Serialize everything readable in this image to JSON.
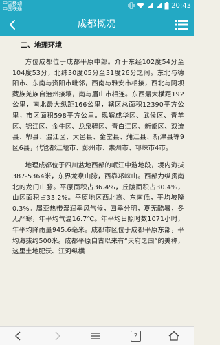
{
  "status": {
    "carrier_line1": "中国移动",
    "carrier_line2": "中国联通",
    "time": "20:43"
  },
  "header": {
    "title": "成都概况"
  },
  "content": {
    "heading": "二、地理环境",
    "paragraphs": [
      "方位成都位于成都平原中部。介于东经102度54分至104度53分，北纬30度05分至31度26分之间。东北与德阳市、东南与资阳市毗邻，西南与雅安市相接，西北与阿坝藏族羌族自治州接壤，南与眉山市相连。东西最大横距192公里，南北最大纵距166公里，辖区总面积12390平方公里，市区面积598平方公里。现辖成华区、武侯区、青羊区、锦江区、金牛区、龙泉驿区、青白江区、新都区、双流县、郫县、温江区、大邑县、金堂县、蒲江县、新津县等9区6县，代管都江堰市、彭州市、崇州市、邛崃市4市。",
      "地理成都位于四川盆地西部的岷江中游地段，境内海拔387-5364米，东界龙泉山脉，西靠邛崃山。西部为纵贯南北的龙门山脉。平原面积占36.4%，丘陵面积占30.4%，山区面积占33.2%。平原地区西北高、东南低，平均坡降0.3%。属亚热带湿润季风气候，四季分明，夏无酷暑，冬无严寒，年平均气温16.7℃。年平均日照时数1071小时，年平均降雨量945.6毫米。成都市区位于成都平原东部，平均海拔约500米。成都平原自古以来有“天府之国”的美称，这里土地肥沃、江河纵横"
    ]
  },
  "bottom_nav": {
    "page_count": "2"
  }
}
